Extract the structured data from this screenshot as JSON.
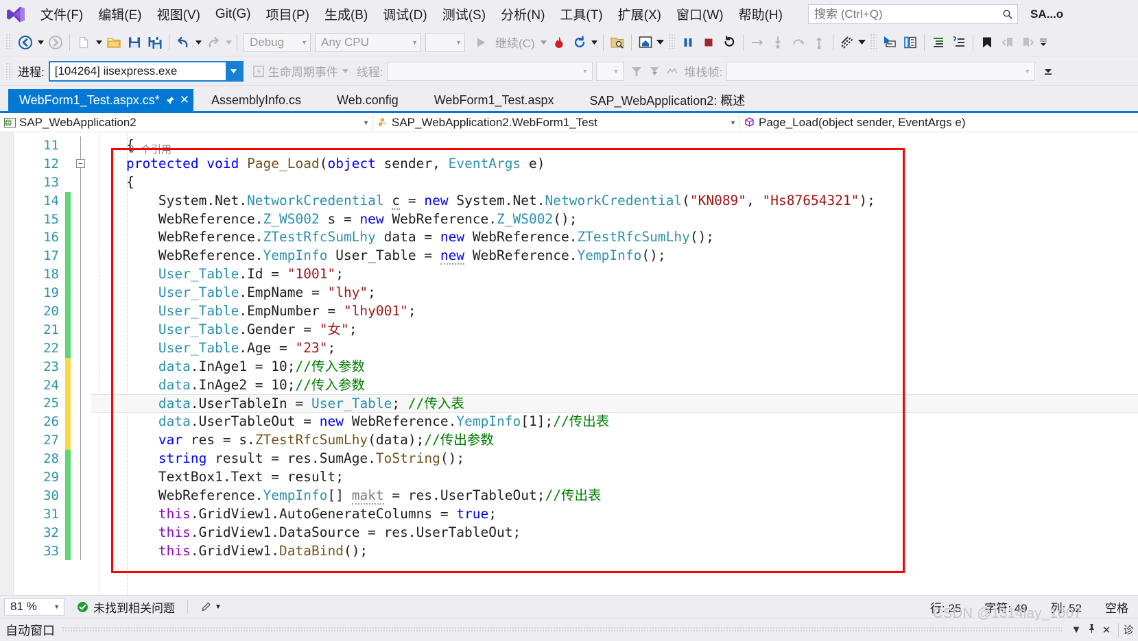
{
  "menu": {
    "logo_icon": "visual-studio-logo",
    "items": [
      {
        "label": "文件(F)"
      },
      {
        "label": "编辑(E)"
      },
      {
        "label": "视图(V)"
      },
      {
        "label": "Git(G)"
      },
      {
        "label": "项目(P)"
      },
      {
        "label": "生成(B)"
      },
      {
        "label": "调试(D)"
      },
      {
        "label": "测试(S)"
      },
      {
        "label": "分析(N)"
      },
      {
        "label": "工具(T)"
      },
      {
        "label": "扩展(X)"
      },
      {
        "label": "窗口(W)"
      },
      {
        "label": "帮助(H)"
      }
    ],
    "search_placeholder": "搜索 (Ctrl+Q)",
    "search_value": "",
    "search_icon": "search-icon",
    "account": "SA...o"
  },
  "toolbar": {
    "back_icon": "navigate-back-icon",
    "forward_icon": "navigate-forward-icon",
    "new_file_icon": "new-file-icon",
    "open_file_icon": "open-folder-icon",
    "save_icon": "save-icon",
    "save_all_icon": "save-all-icon",
    "undo_icon": "undo-icon",
    "redo_icon": "redo-icon",
    "config_value": "Debug",
    "platform_value": "Any CPU",
    "startup_value": "",
    "continue_label": "继续(C)",
    "run_icon": "play-icon",
    "hotreload_icon": "hot-reload-flame-icon",
    "restart_icon": "restart-icon",
    "search_folder_icon": "find-in-files-icon",
    "home_icon": "home-window-icon",
    "pause_icon": "pause-icon",
    "stop_icon": "stop-icon",
    "restart_debug_icon": "restart-debug-icon",
    "step_over_icon": "step-over-icon",
    "step_into_icon": "step-into-icon",
    "step_out_icon": "step-out-icon",
    "show_next_icon": "show-next-statement-icon",
    "diagnostics_icon": "diagnostics-icon",
    "cursor_icon": "select-element-icon",
    "layout_icon": "layout-panel-icon",
    "indent_icon": "comment-icon",
    "uncomment_icon": "uncomment-icon",
    "bookmark_icon": "bookmark-icon",
    "prev_bookmark_icon": "previous-bookmark-icon",
    "next_bookmark_icon": "next-bookmark-icon",
    "overflow_icon": "toolbar-overflow-icon"
  },
  "debugbar": {
    "process_label": "进程:",
    "process_value": "[104264] iisexpress.exe",
    "lifecycle_icon": "lifecycle-event-icon",
    "lifecycle_label": "生命周期事件",
    "thread_label": "线程:",
    "thread_value": "",
    "filter_icon": "filter-icon",
    "filter_down_icon": "filter-down-icon",
    "noise_icon": "noise-icon",
    "stackframe_label": "堆栈帧:",
    "stackframe_value": "",
    "overflow_icon": "overflow-icon"
  },
  "tabs": [
    {
      "label": "WebForm1_Test.aspx.cs*",
      "active": true,
      "pin_icon": "pin-icon",
      "close_icon": "close-icon"
    },
    {
      "label": "AssemblyInfo.cs",
      "active": false
    },
    {
      "label": "Web.config",
      "active": false
    },
    {
      "label": "WebForm1_Test.aspx",
      "active": false
    },
    {
      "label": "SAP_WebApplication2: 概述",
      "active": false
    }
  ],
  "navbar": {
    "project_icon": "web-project-icon",
    "project": "SAP_WebApplication2",
    "class_icon": "class-icon",
    "class": "SAP_WebApplication2.WebForm1_Test",
    "member_icon": "method-icon",
    "member": "Page_Load(object sender, EventArgs e)",
    "dropdown_icon": "chevron-down-icon"
  },
  "editor": {
    "reference_hint": "0 个引用",
    "first_line": 11,
    "lines": [
      {
        "num": 11,
        "change": "",
        "fold": "line",
        "text_plain": "    {"
      },
      {
        "num": 12,
        "change": "",
        "fold": "minus",
        "text_plain": "    protected void Page_Load(object sender, EventArgs e)"
      },
      {
        "num": 13,
        "change": "",
        "fold": "line",
        "text_plain": "    {"
      },
      {
        "num": 14,
        "change": "green",
        "fold": "line",
        "text_plain": "        System.Net.NetworkCredential c = new System.Net.NetworkCredential(\"KN089\", \"Hs87654321\");"
      },
      {
        "num": 15,
        "change": "green",
        "fold": "line",
        "text_plain": "        WebReference.Z_WS002 s = new WebReference.Z_WS002();"
      },
      {
        "num": 16,
        "change": "green",
        "fold": "line",
        "text_plain": "        WebReference.ZTestRfcSumLhy data = new WebReference.ZTestRfcSumLhy();"
      },
      {
        "num": 17,
        "change": "green",
        "fold": "line",
        "text_plain": "        WebReference.YempInfo User_Table = new WebReference.YempInfo();"
      },
      {
        "num": 18,
        "change": "green",
        "fold": "line",
        "text_plain": "        User_Table.Id = \"1001\";"
      },
      {
        "num": 19,
        "change": "green",
        "fold": "line",
        "text_plain": "        User_Table.EmpName = \"lhy\";"
      },
      {
        "num": 20,
        "change": "green",
        "fold": "line",
        "text_plain": "        User_Table.EmpNumber = \"lhy001\";"
      },
      {
        "num": 21,
        "change": "green",
        "fold": "line",
        "text_plain": "        User_Table.Gender = \"女\";"
      },
      {
        "num": 22,
        "change": "green",
        "fold": "line",
        "text_plain": "        User_Table.Age = \"23\";"
      },
      {
        "num": 23,
        "change": "yellow",
        "fold": "line",
        "text_plain": "        data.InAge1 = 10;//传入参数"
      },
      {
        "num": 24,
        "change": "yellow",
        "fold": "line",
        "text_plain": "        data.InAge2 = 10;//传入参数"
      },
      {
        "num": 25,
        "change": "yellow",
        "fold": "line",
        "text_plain": "        data.UserTableIn = User_Table; //传入表",
        "current": true
      },
      {
        "num": 26,
        "change": "yellow",
        "fold": "line",
        "text_plain": "        data.UserTableOut = new WebReference.YempInfo[1];//传出表"
      },
      {
        "num": 27,
        "change": "yellow",
        "fold": "line",
        "text_plain": "        var res = s.ZTestRfcSumLhy(data);//传出参数"
      },
      {
        "num": 28,
        "change": "green",
        "fold": "line",
        "text_plain": "        string result = res.SumAge.ToString();"
      },
      {
        "num": 29,
        "change": "green",
        "fold": "line",
        "text_plain": "        TextBox1.Text = result;"
      },
      {
        "num": 30,
        "change": "green",
        "fold": "line",
        "text_plain": "        WebReference.YempInfo[] makt = res.UserTableOut;//传出表"
      },
      {
        "num": 31,
        "change": "green",
        "fold": "line",
        "text_plain": "        this.GridView1.AutoGenerateColumns = true;"
      },
      {
        "num": 32,
        "change": "green",
        "fold": "line",
        "text_plain": "        this.GridView1.DataSource = res.UserTableOut;"
      },
      {
        "num": 33,
        "change": "green",
        "fold": "line",
        "text_plain": "        this.GridView1.DataBind();"
      }
    ]
  },
  "statusbar": {
    "zoom": "81 %",
    "health_icon": "success-check-icon",
    "health_text": "未找到相关问题",
    "pen_icon": "annotation-pen-icon",
    "line_label": "行: 25",
    "char_label": "字符: 49",
    "col_label": "列: 52",
    "space_label": "空格"
  },
  "bottompanel": {
    "title": "自动窗口",
    "dropdown_icon": "chevron-down-icon",
    "pin_icon": "pin-icon",
    "close_icon": "close-icon",
    "side_label": "诊"
  },
  "watermark": "CSDN @1314lay_1007",
  "colors": {
    "accent": "#0078d4",
    "annotation_red": "#ff0000",
    "keyword": "#0000ff",
    "type": "#2b91af",
    "string": "#a31515",
    "comment": "#008000",
    "method": "#74531f",
    "linenum": "#2b91af",
    "change_added": "#57d873",
    "change_unsaved": "#f9d949"
  }
}
